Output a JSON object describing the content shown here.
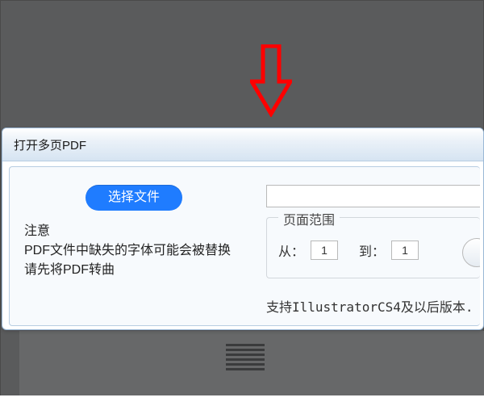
{
  "dialog": {
    "title": "打开多页PDF",
    "select_button": "选择文件",
    "path_value": "",
    "note": {
      "heading": "注意",
      "line1": "PDF文件中缺失的字体可能会被替换",
      "line2": "请先将PDF转曲"
    },
    "range": {
      "title": "页面范围",
      "from_label": "从：",
      "from_value": "1",
      "to_label": "到：",
      "to_value": "1"
    },
    "support_text": "支持IllustratorCS4及以后版本."
  }
}
